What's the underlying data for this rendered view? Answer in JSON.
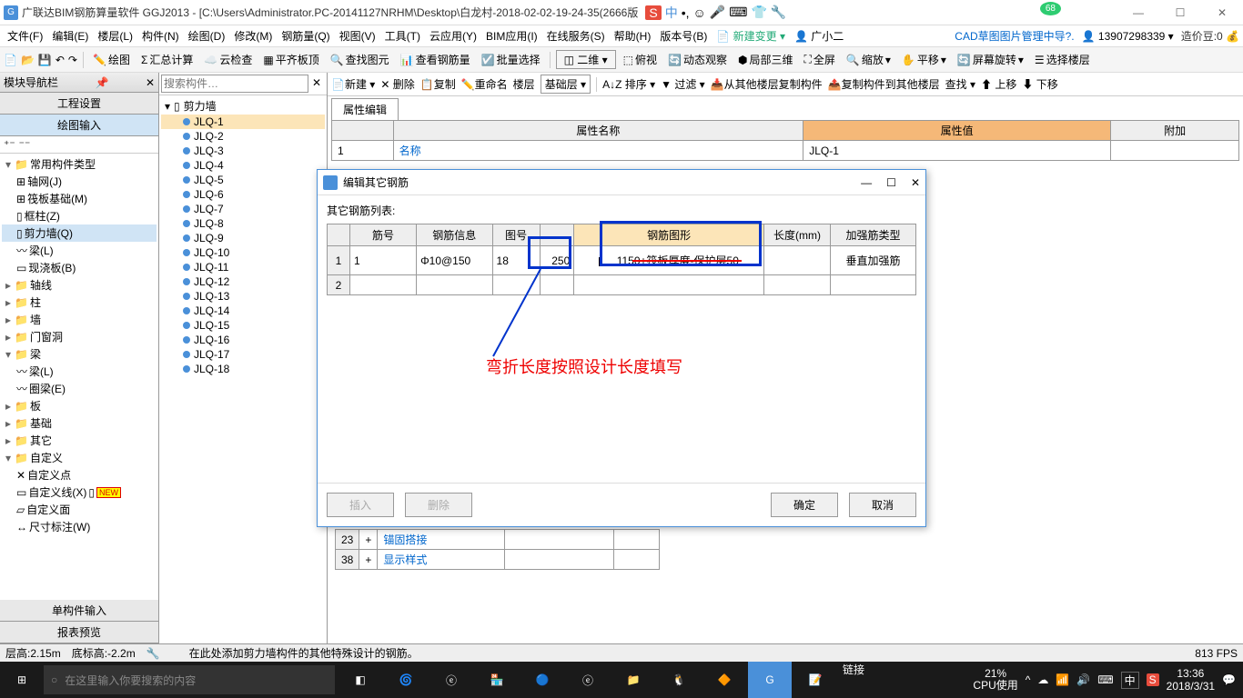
{
  "titlebar": {
    "app_title": "广联达BIM钢筋算量软件 GGJ2013 - [C:\\Users\\Administrator.PC-20141127NRHM\\Desktop\\白龙村-2018-02-02-19-24-35(2666版",
    "ime_char": "中",
    "badge": "68"
  },
  "menubar": {
    "items": [
      "文件(F)",
      "编辑(E)",
      "楼层(L)",
      "构件(N)",
      "绘图(D)",
      "修改(M)",
      "钢筋量(Q)",
      "视图(V)",
      "工具(T)",
      "云应用(Y)",
      "BIM应用(I)",
      "在线服务(S)",
      "帮助(H)",
      "版本号(B)"
    ],
    "new_change": "新建变更",
    "user": "广小二",
    "cad_link": "CAD草图图片管理中导?.",
    "phone": "13907298339",
    "coins_label": "造价豆:0"
  },
  "toolbar": {
    "items": [
      "绘图",
      "汇总计算",
      "云检查",
      "平齐板顶",
      "查找图元",
      "查看钢筋量",
      "批量选择"
    ],
    "dim_label": "二维",
    "view_items": [
      "俯视",
      "动态观察",
      "局部三维",
      "全屏",
      "缩放",
      "平移",
      "屏幕旋转",
      "选择楼层"
    ]
  },
  "left_panel": {
    "header": "模块导航栏",
    "tabs": [
      "工程设置",
      "绘图输入"
    ],
    "categories": {
      "root": "常用构件类型",
      "items": [
        "轴网(J)",
        "筏板基础(M)",
        "框柱(Z)",
        "剪力墙(Q)",
        "梁(L)",
        "现浇板(B)"
      ],
      "others": [
        "轴线",
        "柱",
        "墙",
        "门窗洞",
        "梁",
        "板",
        "基础",
        "其它",
        "自定义"
      ],
      "liang_items": [
        "梁(L)",
        "圈梁(E)"
      ],
      "custom_items": [
        "自定义点",
        "自定义线(X)",
        "自定义面",
        "尺寸标注(W)"
      ],
      "new_badge": "NEW"
    },
    "bottom_tabs": [
      "单构件输入",
      "报表预览"
    ]
  },
  "middle": {
    "toolbar": [
      "新建",
      "删除",
      "复制",
      "重命名",
      "楼层",
      "基础层"
    ],
    "search_placeholder": "搜索构件…",
    "root": "剪力墙",
    "items": [
      "JLQ-1",
      "JLQ-2",
      "JLQ-3",
      "JLQ-4",
      "JLQ-5",
      "JLQ-6",
      "JLQ-7",
      "JLQ-8",
      "JLQ-9",
      "JLQ-10",
      "JLQ-11",
      "JLQ-12",
      "JLQ-13",
      "JLQ-14",
      "JLQ-15",
      "JLQ-16",
      "JLQ-17",
      "JLQ-18"
    ]
  },
  "right": {
    "toolbar": [
      "排序",
      "过滤",
      "从其他楼层复制构件",
      "复制构件到其他楼层",
      "查找",
      "上移",
      "下移"
    ],
    "prop_tab": "属性编辑",
    "headers": [
      "属性名称",
      "属性值",
      "附加"
    ],
    "row1_num": "1",
    "row1_name": "名称",
    "row1_val": "JLQ-1"
  },
  "dialog": {
    "title": "编辑其它钢筋",
    "label": "其它钢筋列表:",
    "headers": [
      "筋号",
      "钢筋信息",
      "图号",
      "",
      "钢筋图形",
      "长度(mm)",
      "加强筋类型"
    ],
    "row1": {
      "num": "1",
      "jin": "1",
      "info": "Φ10@150",
      "tuhao": "18",
      "bend": "250",
      "shape": "1150+筏板厚度-保护层",
      "len_suffix": "50",
      "type": "垂直加强筋"
    },
    "row2_num": "2",
    "btn_insert": "插入",
    "btn_delete": "删除",
    "btn_ok": "确定",
    "btn_cancel": "取消"
  },
  "annotation": "弯折长度按照设计长度填写",
  "bottom_props": {
    "r1_num": "23",
    "r1_label": "锚固搭接",
    "r2_num": "38",
    "r2_label": "显示样式"
  },
  "statusbar": {
    "floor_h": "层高:2.15m",
    "bottom_h": "底标高:-2.2m",
    "hint": "在此处添加剪力墙构件的其他特殊设计的钢筋。",
    "fps": "813 FPS"
  },
  "taskbar": {
    "search_placeholder": "在这里输入你要搜索的内容",
    "link_label": "链接",
    "cpu_pct": "21%",
    "cpu_label": "CPU使用",
    "ime": "中",
    "time": "13:36",
    "date": "2018/3/31"
  }
}
